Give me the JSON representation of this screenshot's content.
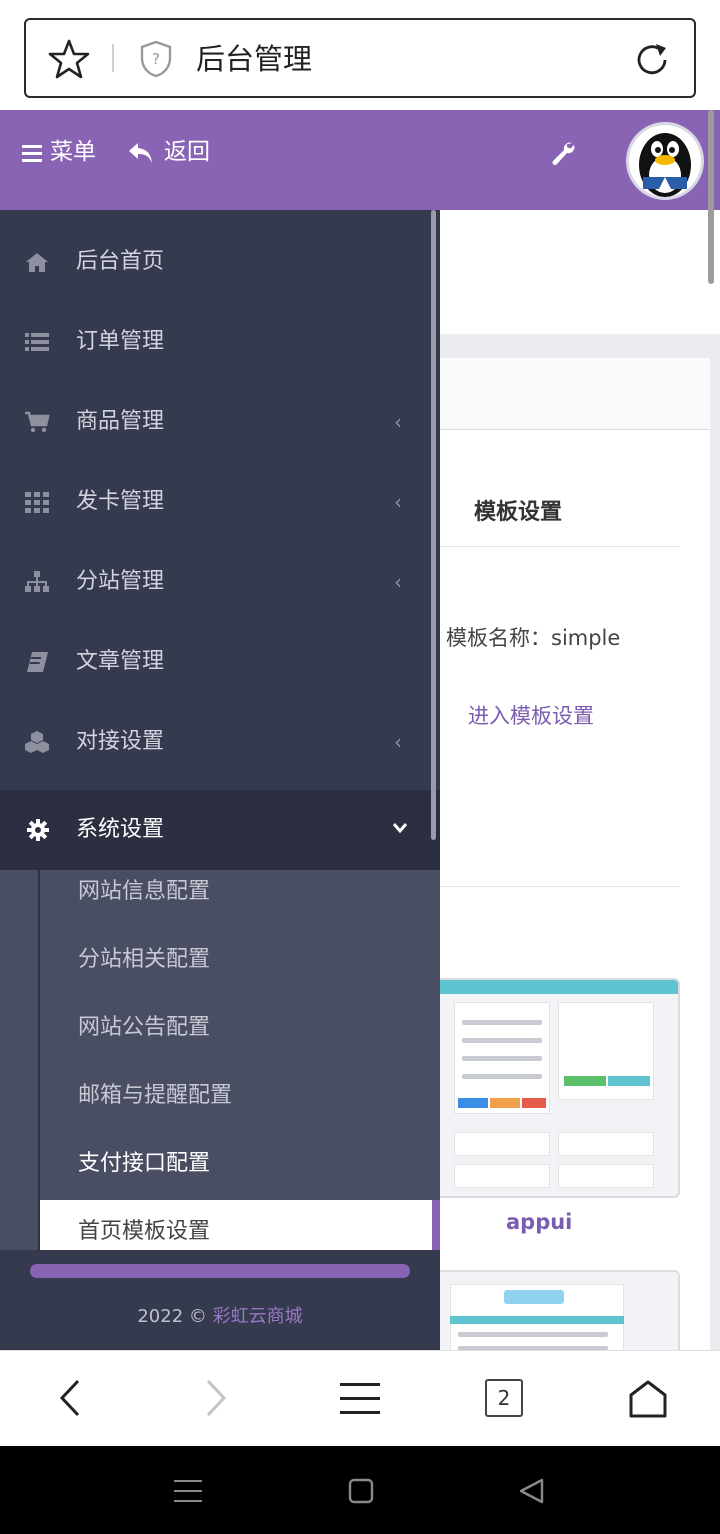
{
  "browser": {
    "title": "后台管理",
    "tab_count": "2"
  },
  "header": {
    "menu_label": "菜单",
    "back_label": "返回"
  },
  "sidebar": {
    "items": [
      {
        "label": "后台首页",
        "icon": "home-icon",
        "has_arrow": false
      },
      {
        "label": "订单管理",
        "icon": "list-icon",
        "has_arrow": true
      },
      {
        "label": "商品管理",
        "icon": "cart-icon",
        "has_arrow": true
      },
      {
        "label": "发卡管理",
        "icon": "grid-icon",
        "has_arrow": true
      },
      {
        "label": "分站管理",
        "icon": "sitemap-icon",
        "has_arrow": true
      },
      {
        "label": "文章管理",
        "icon": "book-icon",
        "has_arrow": false
      },
      {
        "label": "对接设置",
        "icon": "cubes-icon",
        "has_arrow": true
      }
    ],
    "active_item": {
      "label": "系统设置",
      "icon": "gear-icon"
    },
    "submenu": [
      "网站信息配置",
      "分站相关配置",
      "网站公告配置",
      "邮箱与提醒配置",
      "支付接口配置",
      "首页模板设置"
    ],
    "footer": {
      "year": "2022 ©",
      "brand": "彩虹云商城"
    }
  },
  "main": {
    "section_title": "模板设置",
    "template_name_label": "模板名称：simple",
    "enter_settings_link": "进入模板设置",
    "template_cards": [
      {
        "name": "appui"
      },
      {
        "name": ""
      }
    ]
  },
  "colors": {
    "accent": "#8a64b4",
    "sidebar_bg": "#363a4f",
    "sidebar_active": "#2c2f41",
    "submenu_bg": "#4a4e63"
  }
}
